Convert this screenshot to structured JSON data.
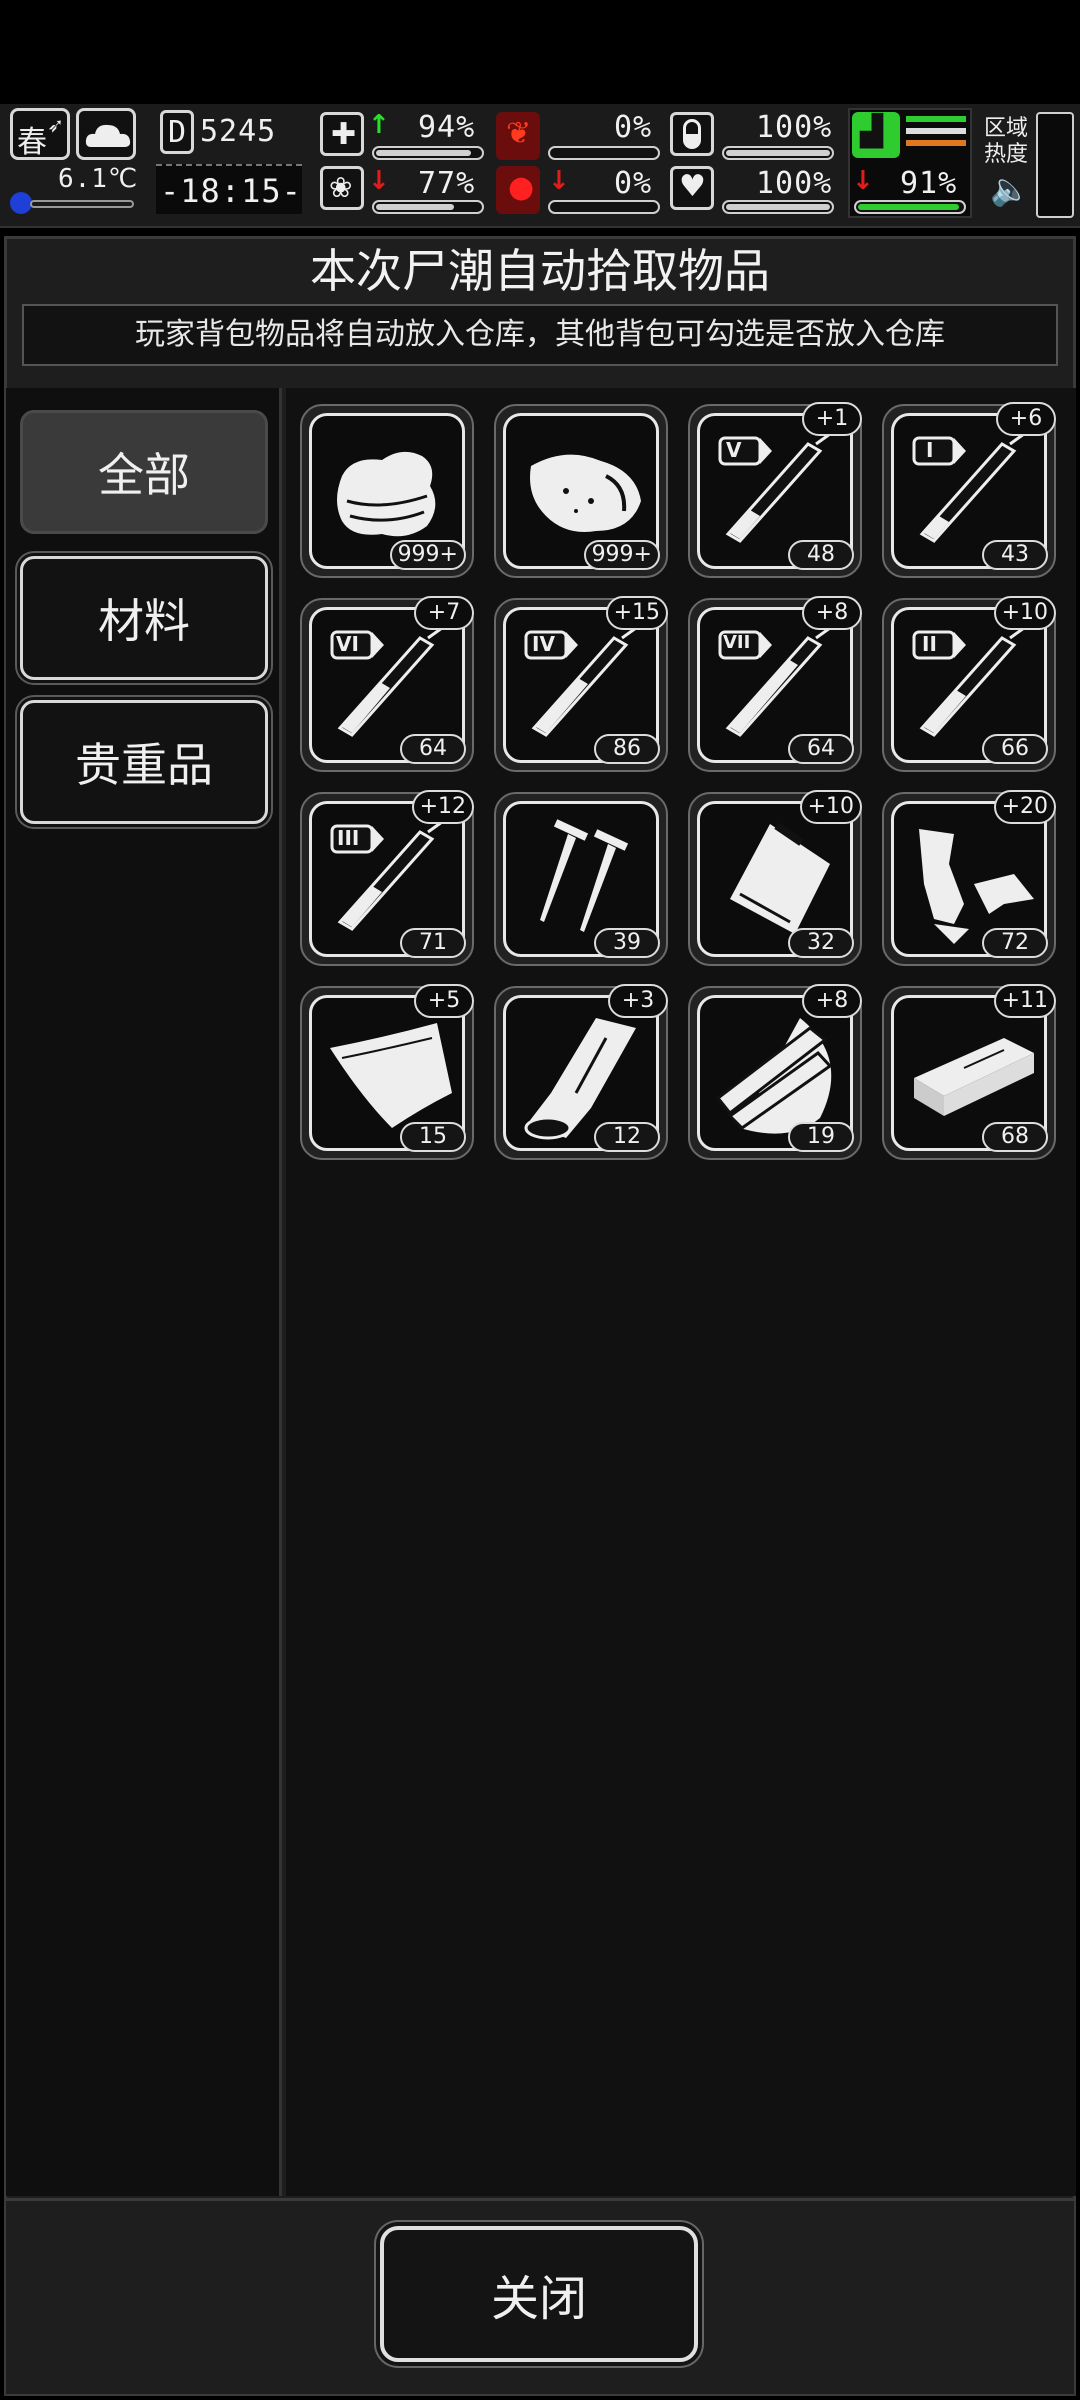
{
  "hud": {
    "season": "春",
    "temperature": "6.1℃",
    "day_label": "D",
    "day_value": "5245",
    "clock": "-18:15-",
    "stats": [
      {
        "value": "94%",
        "icon": "medkit-icon",
        "trend": "up",
        "fill": 0.94
      },
      {
        "value": "0%",
        "icon": "stomach-icon",
        "trend": "none",
        "fill": 0.0
      },
      {
        "value": "100%",
        "icon": "capsule-icon",
        "trend": "none",
        "fill": 1.0
      },
      {
        "value": "77%",
        "icon": "brain-icon",
        "trend": "down",
        "fill": 0.77
      },
      {
        "value": "0%",
        "icon": "blood-drop-icon",
        "trend": "down",
        "fill": 0.0
      },
      {
        "value": "100%",
        "icon": "heart-icon",
        "trend": "none",
        "fill": 1.0
      }
    ],
    "stamina": {
      "value": "91%",
      "trend": "down",
      "fill": 0.91
    },
    "zone_heat_label": "区域\n热度"
  },
  "dialog": {
    "title": "本次尸潮自动拾取物品",
    "subtitle": "玩家背包物品将自动放入仓库，其他背包可勾选是否放入仓库",
    "close_label": "关闭"
  },
  "tabs": [
    {
      "label": "全部",
      "active": true
    },
    {
      "label": "材料",
      "active": false
    },
    {
      "label": "贵重品",
      "active": false
    }
  ],
  "items": [
    {
      "icon": "cloth-icon",
      "count": "999+",
      "plus": ""
    },
    {
      "icon": "meat-icon",
      "count": "999+",
      "plus": ""
    },
    {
      "icon": "syringe-v-icon",
      "numeral": "V",
      "count": "48",
      "plus": "+1"
    },
    {
      "icon": "syringe-i-icon",
      "numeral": "I",
      "count": "43",
      "plus": "+6"
    },
    {
      "icon": "syringe-vi-icon",
      "numeral": "VI",
      "count": "64",
      "plus": "+7"
    },
    {
      "icon": "syringe-iv-icon",
      "numeral": "IV",
      "count": "86",
      "plus": "+15"
    },
    {
      "icon": "syringe-vii-icon",
      "numeral": "VII",
      "count": "64",
      "plus": "+8"
    },
    {
      "icon": "syringe-ii-icon",
      "numeral": "II",
      "count": "66",
      "plus": "+10"
    },
    {
      "icon": "syringe-iii-icon",
      "numeral": "III",
      "count": "71",
      "plus": "+12"
    },
    {
      "icon": "nails-icon",
      "count": "39",
      "plus": ""
    },
    {
      "icon": "plastic-bag-icon",
      "count": "32",
      "plus": "+10"
    },
    {
      "icon": "scrap-metal-icon",
      "count": "72",
      "plus": "+20"
    },
    {
      "icon": "canvas-sheet-icon",
      "count": "15",
      "plus": "+5"
    },
    {
      "icon": "leather-roll-icon",
      "count": "12",
      "plus": "+3"
    },
    {
      "icon": "wood-planks-icon",
      "count": "19",
      "plus": "+8"
    },
    {
      "icon": "brick-icon",
      "count": "68",
      "plus": "+11"
    }
  ]
}
